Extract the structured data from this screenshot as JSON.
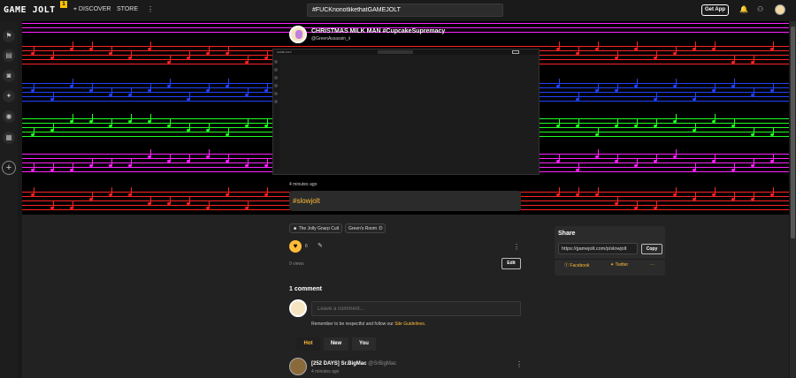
{
  "topbar": {
    "logo": "GAME JOLT",
    "badge": "1",
    "discover": "DISCOVER",
    "store": "STORE",
    "more": "⋮",
    "search_value": "#FUCKnonotlikethatGAMEJOLT",
    "get_app": "Get App"
  },
  "sidebar": {
    "add": "+"
  },
  "post": {
    "title": "CHRISTMAS MILK MAN #CupcakeSupremacy",
    "user": "@GreenAssassin_ii",
    "time": "4 minutes ago",
    "hashtag": "#slowjolt",
    "tags": [
      "The Jolly Gnarp Cult",
      "Green's Room :D"
    ],
    "likes": "6",
    "views": "9 views",
    "edit": "Edit",
    "screenshot_logo": "GAME JOLT"
  },
  "comments": {
    "heading": "1 comment",
    "placeholder": "Leave a comment...",
    "note_prefix": "Remember to be respectful and follow our ",
    "note_link": "Site Guidelines",
    "note_suffix": ".",
    "tabs": [
      "Hot",
      "New",
      "You"
    ],
    "first": {
      "name": "[252 DAYS] Sr.BigMac",
      "handle": "@SrBigMac",
      "time": "4 minutes ago"
    }
  },
  "share": {
    "heading": "Share",
    "url": "https://gamejolt.com/p/slowjolt",
    "copy": "Copy",
    "facebook": "Facebook",
    "twitter": "Twitter",
    "more": "···"
  },
  "colors": {
    "accent": "#ffbc36",
    "staff_magenta": "#ff22ff",
    "staff_red": "#ff2222",
    "staff_blue": "#2244ff",
    "staff_green": "#22ff22"
  }
}
